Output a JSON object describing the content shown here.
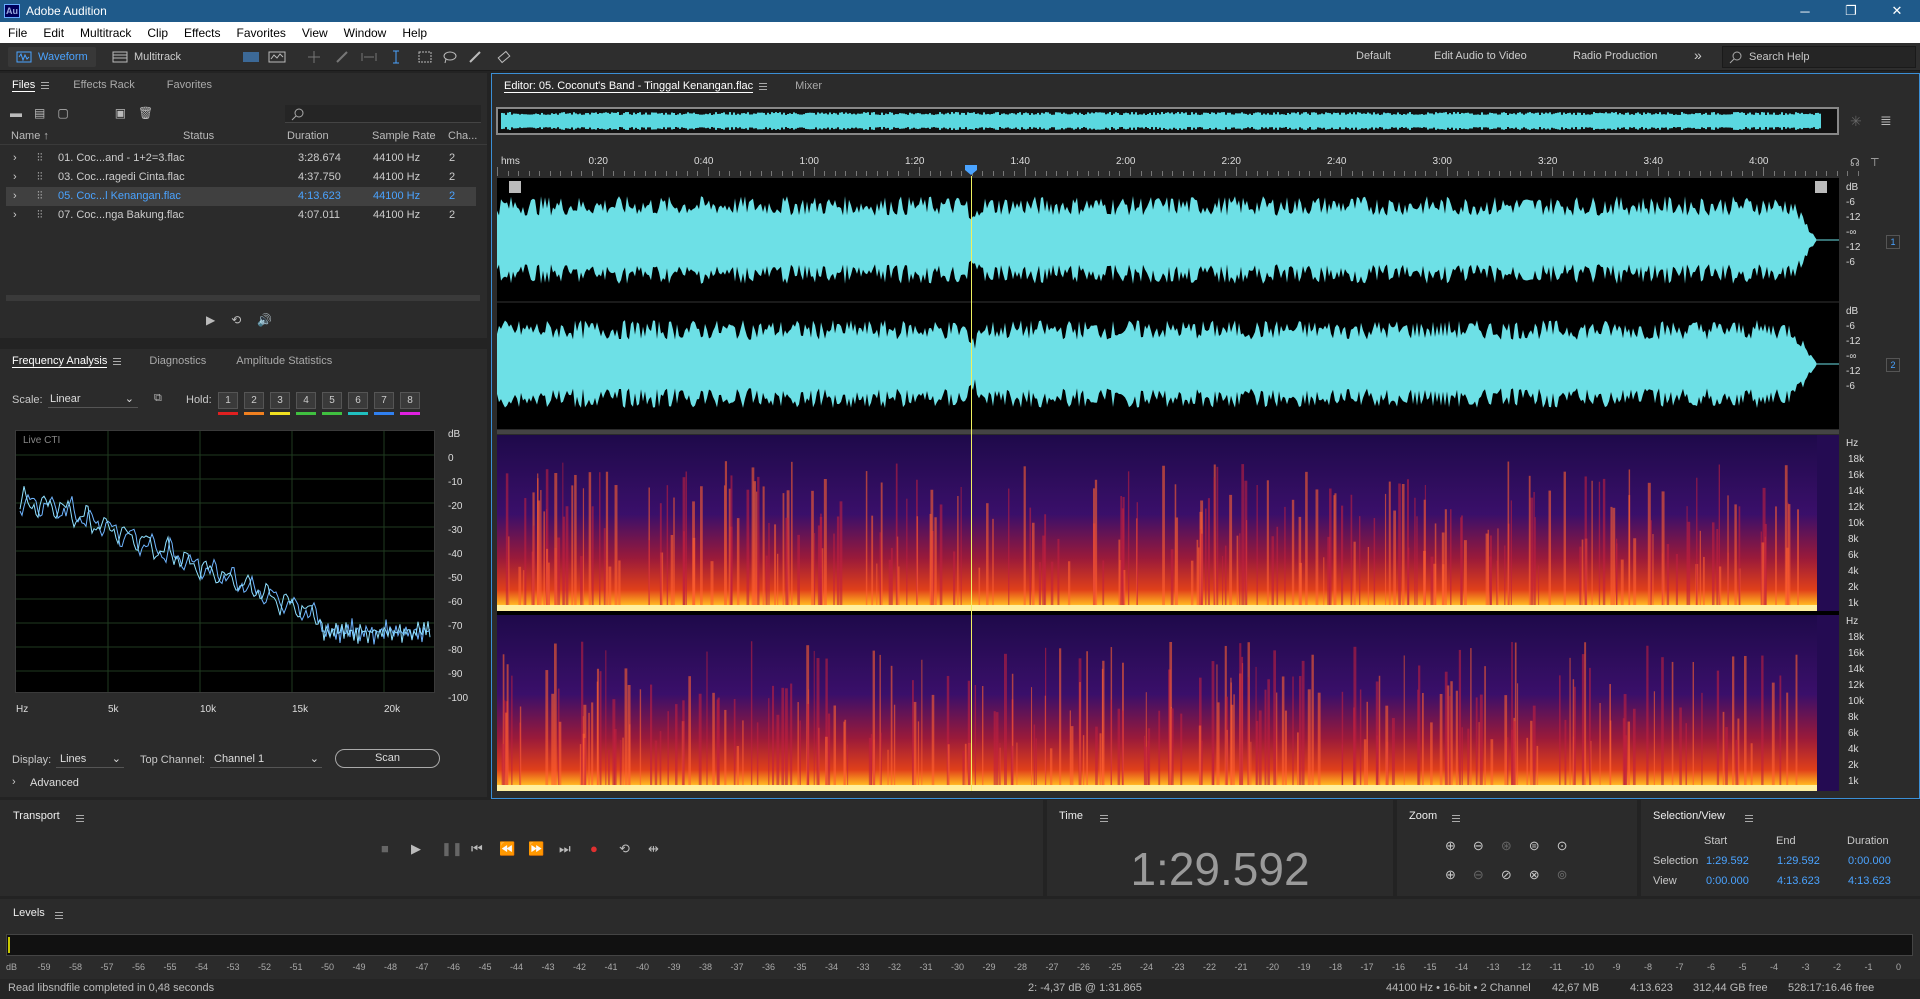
{
  "app": {
    "title": "Adobe Audition",
    "logo": "Au"
  },
  "window_controls": [
    "─",
    "❐",
    "✕"
  ],
  "menu": [
    "File",
    "Edit",
    "Multitrack",
    "Clip",
    "Effects",
    "Favorites",
    "View",
    "Window",
    "Help"
  ],
  "toolbar": {
    "waveform": "Waveform",
    "multitrack": "Multitrack",
    "workspaces": [
      "Default",
      "Edit Audio to Video",
      "Radio Production"
    ],
    "more": "»",
    "search": "Search Help"
  },
  "files_panel": {
    "tabs": [
      "Files",
      "Effects Rack",
      "Favorites"
    ],
    "columns": [
      "Name",
      "Status",
      "Duration",
      "Sample Rate",
      "Cha..."
    ],
    "rows": [
      {
        "name": "01. Coc...and - 1+2=3.flac",
        "duration": "3:28.674",
        "rate": "44100 Hz",
        "ch": "2"
      },
      {
        "name": "03. Coc...ragedi Cinta.flac",
        "duration": "4:37.750",
        "rate": "44100 Hz",
        "ch": "2"
      },
      {
        "name": "05. Coc...l Kenangan.flac",
        "duration": "4:13.623",
        "rate": "44100 Hz",
        "ch": "2"
      },
      {
        "name": "07. Coc...nga Bakung.flac",
        "duration": "4:07.011",
        "rate": "44100 Hz",
        "ch": "2"
      }
    ],
    "selected_index": 2
  },
  "analysis_panel": {
    "tabs": [
      "Frequency Analysis",
      "Diagnostics",
      "Amplitude Statistics"
    ],
    "scale_label": "Scale:",
    "scale_value": "Linear",
    "hold_label": "Hold:",
    "hold_buttons": [
      "1",
      "2",
      "3",
      "4",
      "5",
      "6",
      "7",
      "8"
    ],
    "hold_colors": [
      "#e02020",
      "#f08020",
      "#f0e020",
      "#40c040",
      "#40c040",
      "#20c0c0",
      "#3080f0",
      "#e020e0"
    ],
    "graph_label": "Live CTI",
    "db_ticks": [
      "dB",
      "0",
      "-10",
      "-20",
      "-30",
      "-40",
      "-50",
      "-60",
      "-70",
      "-80",
      "-90",
      "-100"
    ],
    "hz_ticks": [
      "Hz",
      "5k",
      "10k",
      "15k",
      "20k"
    ],
    "display_label": "Display:",
    "display_value": "Lines",
    "top_channel_label": "Top Channel:",
    "top_channel_value": "Channel 1",
    "scan": "Scan",
    "advanced": "Advanced"
  },
  "editor": {
    "tab": "Editor: 05. Coconut's Band - Tinggal Kenangan.flac",
    "mixer": "Mixer",
    "time_ticks": [
      "hms",
      "0:20",
      "0:40",
      "1:00",
      "1:20",
      "1:40",
      "2:00",
      "2:20",
      "2:40",
      "3:00",
      "3:20",
      "3:40",
      "4:00"
    ],
    "wave_ruler": [
      "dB",
      "-6",
      "-12",
      "-∞",
      "-12",
      "-6"
    ],
    "spec_ruler": [
      "Hz",
      "18k",
      "16k",
      "14k",
      "12k",
      "10k",
      "8k",
      "6k",
      "4k",
      "2k",
      "1k"
    ],
    "channels": [
      "1",
      "2"
    ]
  },
  "transport": {
    "title": "Transport"
  },
  "time": {
    "title": "Time",
    "value": "1:29.592"
  },
  "zoom": {
    "title": "Zoom"
  },
  "selection": {
    "title": "Selection/View",
    "headers": [
      "Start",
      "End",
      "Duration"
    ],
    "rows": [
      {
        "label": "Selection",
        "start": "1:29.592",
        "end": "1:29.592",
        "duration": "0:00.000"
      },
      {
        "label": "View",
        "start": "0:00.000",
        "end": "4:13.623",
        "duration": "4:13.623"
      }
    ]
  },
  "levels": {
    "title": "Levels",
    "scale": [
      "dB",
      "-59",
      "-58",
      "-57",
      "-56",
      "-55",
      "-54",
      "-53",
      "-52",
      "-51",
      "-50",
      "-49",
      "-48",
      "-47",
      "-46",
      "-45",
      "-44",
      "-43",
      "-42",
      "-41",
      "-40",
      "-39",
      "-38",
      "-37",
      "-36",
      "-35",
      "-34",
      "-33",
      "-32",
      "-31",
      "-30",
      "-29",
      "-28",
      "-27",
      "-26",
      "-25",
      "-24",
      "-23",
      "-22",
      "-21",
      "-20",
      "-19",
      "-18",
      "-17",
      "-16",
      "-15",
      "-14",
      "-13",
      "-12",
      "-11",
      "-10",
      "-9",
      "-8",
      "-7",
      "-6",
      "-5",
      "-4",
      "-3",
      "-2",
      "-1",
      "0"
    ]
  },
  "status": {
    "left": "Read libsndfile completed in 0,48 seconds",
    "mid": "2: -4,37 dB @ 1:31.865",
    "format": "44100 Hz • 16-bit • 2 Channel",
    "size": "42,67 MB",
    "duration": "4:13.623",
    "free": "312,44 GB free",
    "free_time": "528:17:16.46 free"
  }
}
